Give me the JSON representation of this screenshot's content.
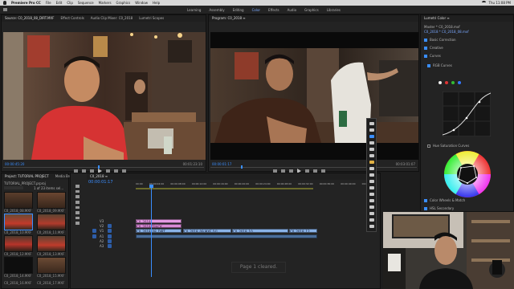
{
  "menubar": {
    "app": "Premiere Pro CC",
    "items": [
      "File",
      "Edit",
      "Clip",
      "Sequence",
      "Markers",
      "Graphics",
      "Window",
      "Help"
    ],
    "clock": "Thu 11:08 PM"
  },
  "workspaces": {
    "tabs": [
      "Learning",
      "Assembly",
      "Editing",
      "Color",
      "Effects",
      "Audio",
      "Graphics",
      "Libraries"
    ],
    "active": "Color"
  },
  "source_monitor": {
    "tabs": [
      "Source: C0_2018_08_DIRT.MXF",
      "Effect Controls",
      "Audio Clip Mixer: C0_2018",
      "Lumetri Scopes"
    ],
    "timecode_in": "00:00:45:20",
    "duration": "00:01:23:10"
  },
  "program_monitor": {
    "tab": "Program: C0_2018 ≡",
    "timecode_in": "00:00:01:17",
    "duration": "00:03:01:07"
  },
  "lumetri": {
    "title": "Lumetri Color ≡",
    "master": "Master * C0_2018.mxf",
    "clip": "C0_2018 * C0_2018_08.mxf",
    "sections": [
      "Basic Correction",
      "Creative",
      "Curves",
      "RGB Curves",
      "Hue Saturation Curves",
      "Color Wheels & Match",
      "HSL Secondary"
    ],
    "accent": "#3a8eff"
  },
  "project": {
    "tabs": [
      "Project: TUTORIAL PROJECT",
      "Media Browser"
    ],
    "path": "TUTORIAL_PROJECT.prproj",
    "count": "1 of 23 items sel...",
    "items": [
      "C0_2018_08.MXF",
      "C0_2018_09.MXF",
      "C0_2018_10.MXF",
      "C0_2018_11.MXF",
      "C0_2018_12.MXF",
      "C0_2018_13.MXF",
      "C0_2018_14.MXF",
      "C0_2018_15.MXF",
      "C0_2018_16.MXF",
      "C0_2018_17.MXF"
    ]
  },
  "timeline": {
    "tab": "C0_2018 ≡",
    "timecode": "00:00:01:17",
    "ruler": [
      "00:00",
      "00:00:04:00",
      "00:00:08:00",
      "00:00:12:00",
      "00:00:16:00",
      "00:00:20:00",
      "00:00:24:00",
      "00:00:28:00",
      "00:00:32:00",
      "00:00:36:00",
      "00:00:40:00",
      "00:00:44:00"
    ],
    "tracks": [
      "V3",
      "V2",
      "V1",
      "A1",
      "A2",
      "A3"
    ],
    "clips": {
      "pink1": "C0_2018",
      "pink2": "C0_2018 TRACK",
      "blue1": "C0_2018_08_DIRT",
      "blue2": "C0_2018_09.MXF [V]",
      "blue3": "C0_2018_10",
      "blue4": "C0_2018_12"
    }
  },
  "toast": "Page 1 cleared."
}
